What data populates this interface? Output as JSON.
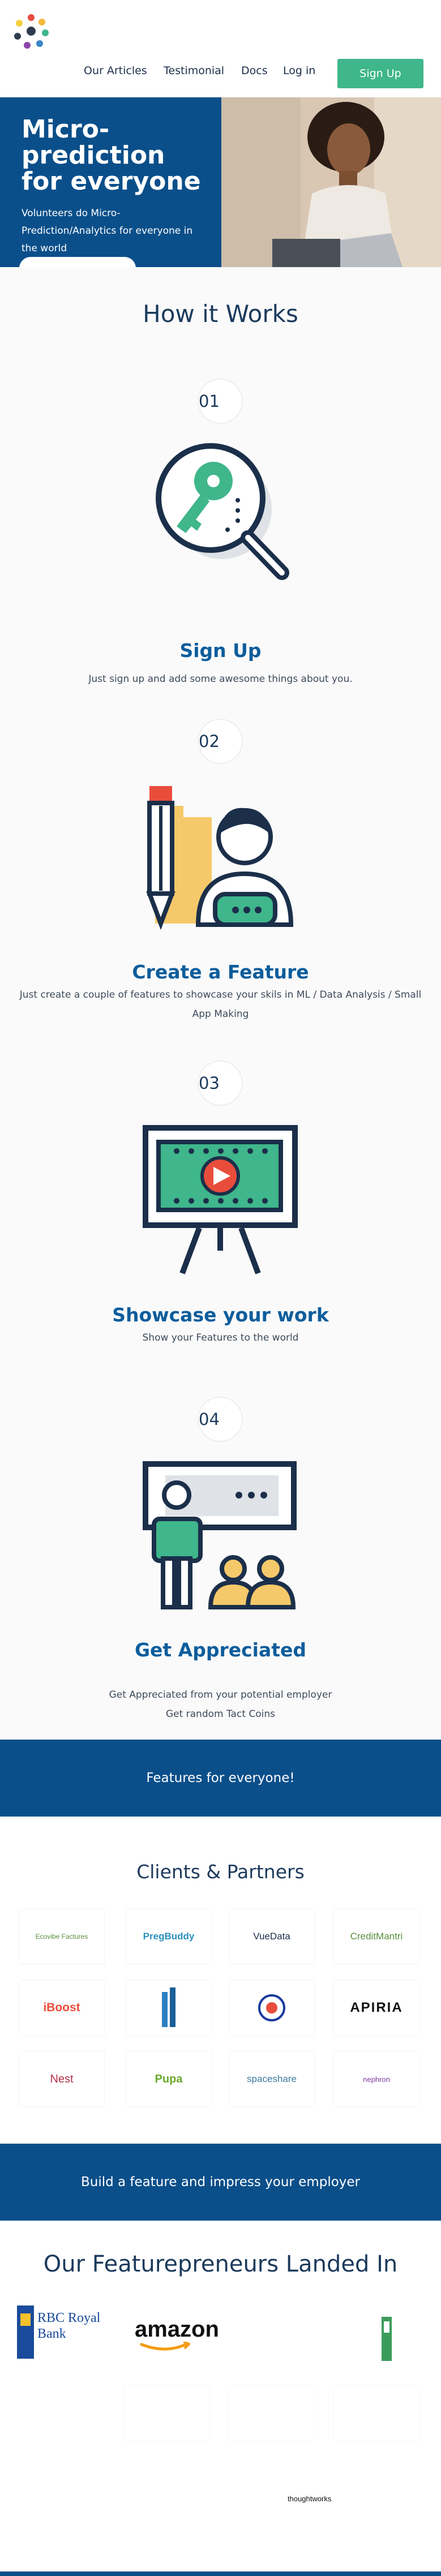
{
  "nav": {
    "items": [
      "Our Articles",
      "Testimonial",
      "Docs",
      "Log in"
    ],
    "signup_label": "Sign Up"
  },
  "hero": {
    "title": "Micro-prediction for everyone",
    "subtitle": "Volunteers do Micro-Prediction/Analytics for everyone in the world"
  },
  "how": {
    "heading": "How it Works",
    "steps": [
      {
        "num": "01",
        "title": "Sign Up",
        "desc": "Just sign up and add some awesome things about you."
      },
      {
        "num": "02",
        "title": "Create a Feature",
        "desc": "Just create a couple of features to showcase your skils in ML / Data Analysis / Small App Making"
      },
      {
        "num": "03",
        "title": "Showcase your work",
        "desc": "Show your Features to the world"
      },
      {
        "num": "04",
        "title": "Get Appreciated",
        "desc": "Get Appreciated from your potential employer",
        "desc2": "Get random Tact Coins"
      }
    ]
  },
  "features_banner": "Features for everyone!",
  "partners": {
    "heading": "Clients & Partners",
    "logos": [
      "Ecovibe Factures",
      "PregBuddy",
      "VueData",
      "CreditMantri",
      "iBoost",
      "Tower",
      "Crest",
      "APIRIA",
      "Nest",
      "Pupa",
      "spaceshare",
      "nephron"
    ]
  },
  "build_banner": "Build a feature and impress your employer",
  "landed": {
    "heading": "Our Featurepreneurs Landed In",
    "logos": [
      "RBC Royal Bank",
      "amazon",
      "",
      "",
      "",
      "",
      "",
      "",
      "thoughtworks"
    ]
  },
  "colors": {
    "primary": "#0b4f8a",
    "accent": "#3fb68b",
    "heading": "#1b3a5c",
    "step_title": "#0d5d9c"
  }
}
